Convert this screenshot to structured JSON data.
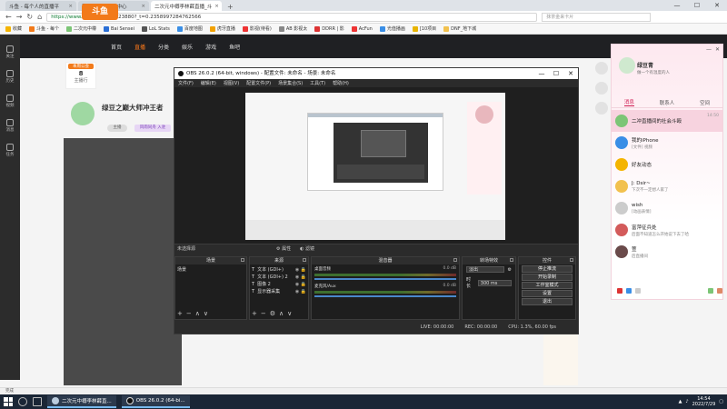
{
  "browser": {
    "tabs": [
      {
        "label": "斗鱼 - 每个人的直播平",
        "active": false
      },
      {
        "label": "我的资料 - 个人中心",
        "active": false
      },
      {
        "label": "二次元中樽李林薛直播_斗",
        "active": true
      }
    ],
    "url_host": "https://www.douyu.com/",
    "url_rest": "9123880?_t=0.2358997284762566",
    "search_placeholder": "抹茶金来卡片",
    "bookmarks": [
      "收藏",
      "斗鱼 - 每个",
      "二次元中樽",
      "Bai Sensei",
      "LoL Stats",
      "百度地图",
      "虎牙直播",
      "影视(待看)",
      "AB 影视太",
      "DDRR | 影",
      "AcFun",
      "光值播画",
      "[10项目",
      "DNF_地下城"
    ]
  },
  "douyu": {
    "logo": "斗鱼",
    "nav": [
      "首页",
      "直播",
      "分类",
      "娱乐",
      "游戏",
      "鱼吧"
    ],
    "nav_active": 1,
    "left_menu": [
      "关注",
      "历史",
      "视频",
      "消息",
      "任务"
    ],
    "stat_tag": "本周公会",
    "stat_value": "8",
    "stat_label": "主播行",
    "room_title": "绿豆之巅大师冲王者",
    "room_tags": [
      "主播",
      "风雨同舟 入驻"
    ],
    "statusbar": "完成"
  },
  "obs": {
    "title": "OBS 26.0.2 (64-bit, windows) - 配置文件: 未命名 - 场景: 未命名",
    "menu": [
      "文件(F)",
      "编辑(E)",
      "视图(V)",
      "配置文件(P)",
      "场景集合(S)",
      "工具(T)",
      "帮助(H)"
    ],
    "mode_label": "未选择源",
    "mode_props": "属性",
    "mode_filters": "滤镜",
    "docks": {
      "scenes": "场景",
      "sources": "来源",
      "mixer": "混音器",
      "transitions": "转场特效",
      "controls": "控件"
    },
    "scene_items": [
      "场景"
    ],
    "source_items": [
      {
        "name": "文本 (GDI+)"
      },
      {
        "name": "文本 (GDI+) 2"
      },
      {
        "name": "图像 2"
      },
      {
        "name": "显示器采集"
      }
    ],
    "mixer_rows": [
      {
        "name": "桌面音频",
        "db": "0.0 dB"
      },
      {
        "name": "麦克风/Aux",
        "db": "0.0 dB"
      }
    ],
    "transition_type": "淡出",
    "duration_label": "时长",
    "duration_value": "300 ms",
    "controls": [
      "停止推流",
      "开始录制",
      "工作室模式",
      "设置",
      "退出"
    ],
    "status": {
      "live": "LIVE: 00:00:00",
      "rec": "REC: 00:00:00",
      "cpu": "CPU: 1.3%, 60.00 fps"
    }
  },
  "qq": {
    "name": "绿豆青",
    "signature": "做一个有温度的人",
    "tabs": [
      "消息",
      "联系人",
      "空间"
    ],
    "tab_active": 0,
    "items": [
      {
        "name": "二冲直播间的社会斗殴",
        "preview": "",
        "time": "14:50",
        "color": "#7cc576"
      },
      {
        "name": "我的iPhone",
        "preview": "[文件] 视频",
        "time": "",
        "color": "#3a8ee6"
      },
      {
        "name": "好友动态",
        "preview": "",
        "time": "",
        "color": "#f4b400"
      },
      {
        "name": "J: Dsir~",
        "preview": "下次不一定想人家了",
        "time": "",
        "color": "#f2c14e"
      },
      {
        "name": "wish",
        "preview": "[动画表情]",
        "time": "",
        "color": "#cccccc"
      },
      {
        "name": "富萍征兵处",
        "preview": "后面不知道怎么开始说下去了哈",
        "time": "",
        "color": "#d35b5b"
      },
      {
        "name": "萱",
        "preview": "后直播间",
        "time": "",
        "color": "#6a4a4a"
      }
    ]
  },
  "taskbar": {
    "apps": [
      "二次元中樽李林薛直...",
      "OBS 26.0.2 (64-bi..."
    ],
    "time": "14:54",
    "date": "2022/7/29"
  }
}
